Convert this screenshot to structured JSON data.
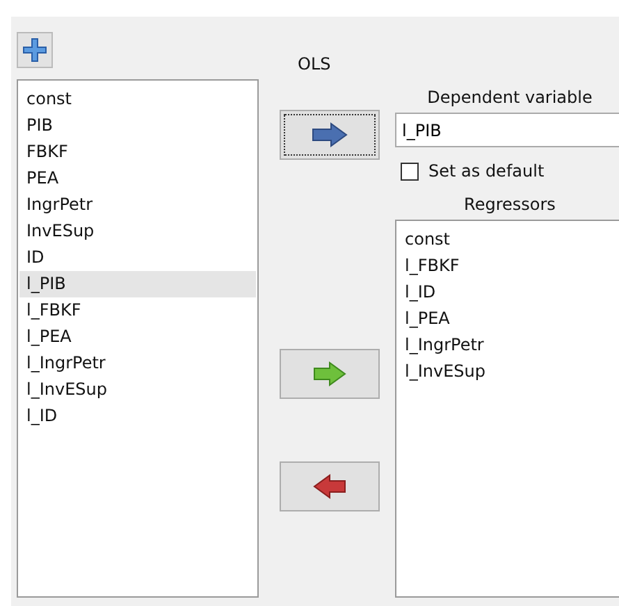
{
  "title": "OLS",
  "variables": [
    {
      "label": "const",
      "selected": false
    },
    {
      "label": "PIB",
      "selected": false
    },
    {
      "label": "FBKF",
      "selected": false
    },
    {
      "label": "PEA",
      "selected": false
    },
    {
      "label": "IngrPetr",
      "selected": false
    },
    {
      "label": "InvESup",
      "selected": false
    },
    {
      "label": "ID",
      "selected": false
    },
    {
      "label": "l_PIB",
      "selected": true
    },
    {
      "label": "l_FBKF",
      "selected": false
    },
    {
      "label": "l_PEA",
      "selected": false
    },
    {
      "label": "l_IngrPetr",
      "selected": false
    },
    {
      "label": "l_InvESup",
      "selected": false
    },
    {
      "label": "l_ID",
      "selected": false
    }
  ],
  "dependent": {
    "label": "Dependent variable",
    "value": "l_PIB"
  },
  "set_as_default": {
    "label": "Set as default",
    "checked": false
  },
  "regressors": {
    "label": "Regressors",
    "items": [
      {
        "label": "const",
        "selected": false
      },
      {
        "label": "l_FBKF",
        "selected": false
      },
      {
        "label": "l_ID",
        "selected": false
      },
      {
        "label": "l_PEA",
        "selected": false
      },
      {
        "label": "l_IngrPetr",
        "selected": false
      },
      {
        "label": "l_InvESup",
        "selected": false
      }
    ]
  },
  "arrow_buttons": [
    {
      "kind": "right",
      "focused": true
    },
    {
      "kind": "add",
      "focused": false
    },
    {
      "kind": "remove",
      "focused": false
    }
  ]
}
